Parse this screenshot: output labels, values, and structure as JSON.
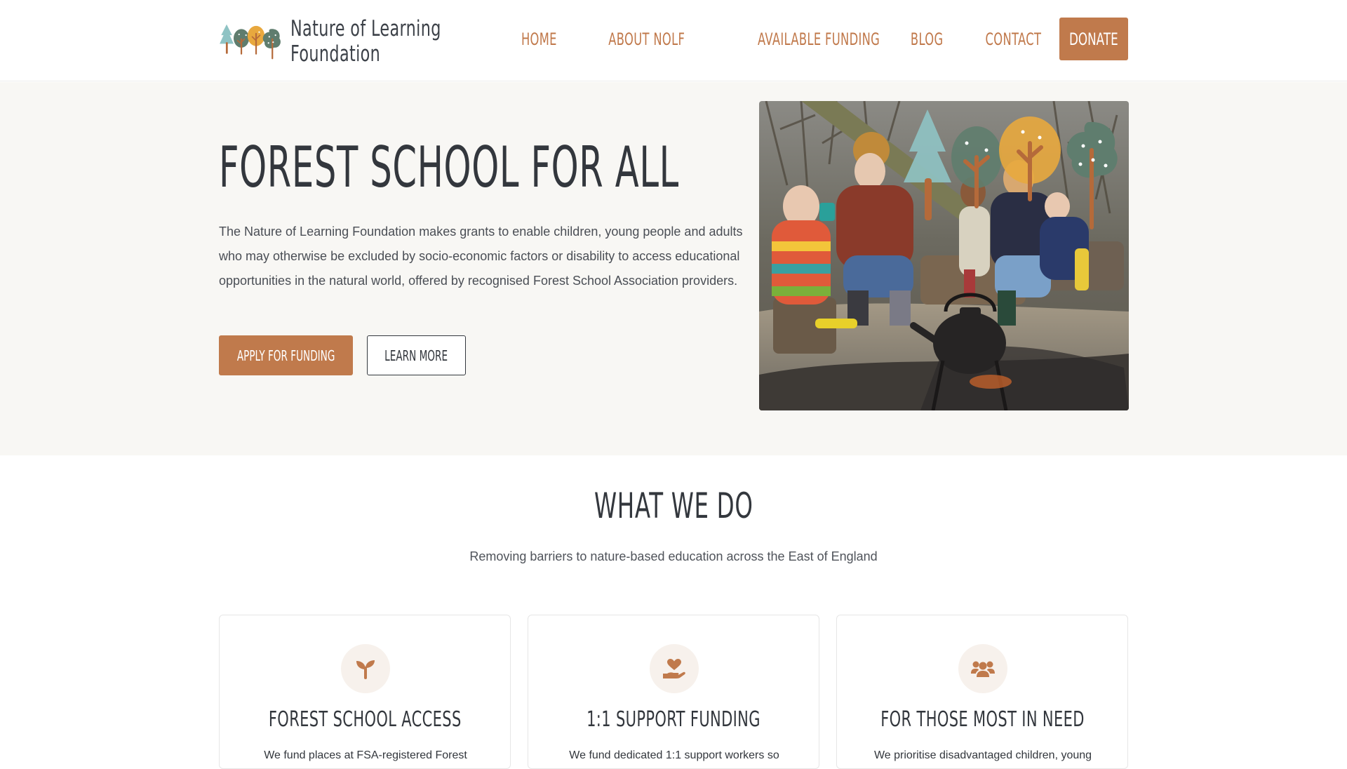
{
  "logo": {
    "line1": "Nature of Learning",
    "line2": "Foundation"
  },
  "nav": {
    "items": [
      "Home",
      "About NOLF",
      "Available Funding",
      "Blog",
      "Contact"
    ],
    "donate_label": "Donate"
  },
  "hero": {
    "title": "Forest School for All",
    "text": "The Nature of Learning Foundation makes grants to enable children, young people and adults who may otherwise be excluded by socio-economic factors or disability to access educational opportunities in the natural world, offered by recognised Forest School Association providers.",
    "primary_button": "Apply for Funding",
    "secondary_button": "Learn More"
  },
  "what_we_do": {
    "title": "What We Do",
    "subtitle": "Removing barriers to nature-based education across the East of England",
    "cards": [
      {
        "icon": "seedling-icon",
        "title": "Forest School Access",
        "text": "We fund places at FSA-registered Forest"
      },
      {
        "icon": "hand-heart-icon",
        "title": "1:1 Support Funding",
        "text": "We fund dedicated 1:1 support workers so"
      },
      {
        "icon": "users-icon",
        "title": "For Those Most in Need",
        "text": "We prioritise disadvantaged children, young"
      }
    ]
  },
  "colors": {
    "accent": "#c07a4c",
    "text": "#33373d",
    "hero_bg": "#f8f7f4",
    "tree_teal": "#8fc3c4",
    "tree_green": "#5f7d6e",
    "tree_yellow": "#e8a83e"
  }
}
